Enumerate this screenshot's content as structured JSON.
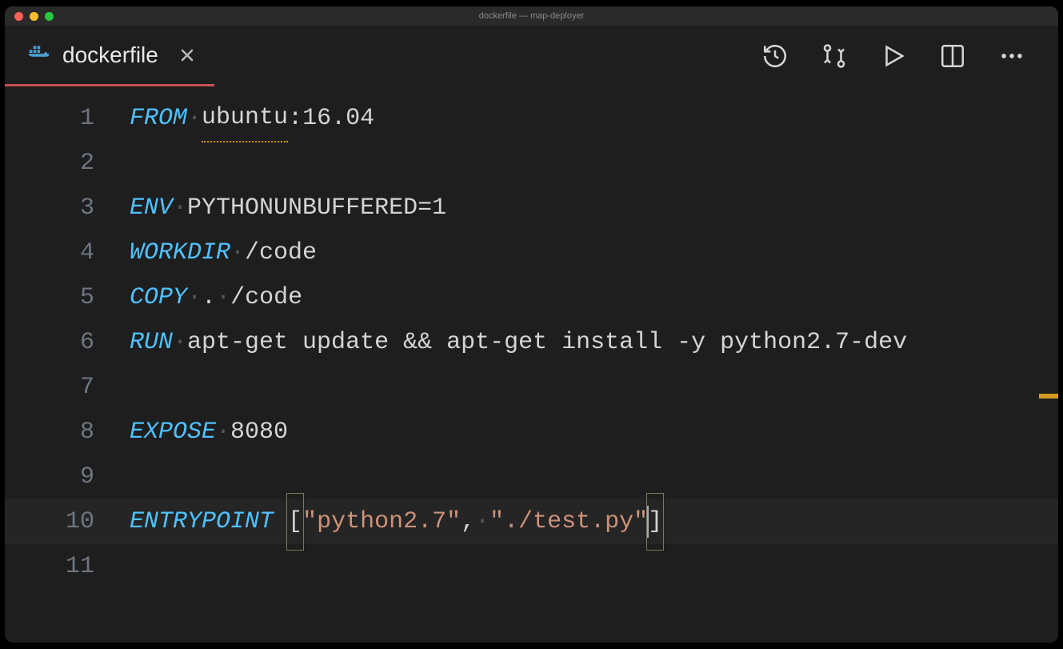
{
  "window": {
    "title": "dockerfile — map-deployer"
  },
  "tab": {
    "filename": "dockerfile"
  },
  "lines": {
    "l1": {
      "num": "1",
      "kw": "FROM",
      "img": "ubuntu",
      "tag": ":16.04"
    },
    "l2": {
      "num": "2"
    },
    "l3": {
      "num": "3",
      "kw": "ENV",
      "rest": "PYTHONUNBUFFERED=1"
    },
    "l4": {
      "num": "4",
      "kw": "WORKDIR",
      "rest": "/code"
    },
    "l5": {
      "num": "5",
      "kw": "COPY",
      "a": ".",
      "b": "/code"
    },
    "l6": {
      "num": "6",
      "kw": "RUN",
      "rest": "apt-get update && apt-get install -y python2.7-dev"
    },
    "l7": {
      "num": "7"
    },
    "l8": {
      "num": "8",
      "kw": "EXPOSE",
      "rest": "8080"
    },
    "l9": {
      "num": "9"
    },
    "l10": {
      "num": "10",
      "kw": "ENTRYPOINT",
      "lb": "[",
      "s1": "\"python2.7\"",
      "comma": ",",
      "s2": "\"./test.py\"",
      "rb": "]"
    },
    "l11": {
      "num": "11"
    }
  }
}
